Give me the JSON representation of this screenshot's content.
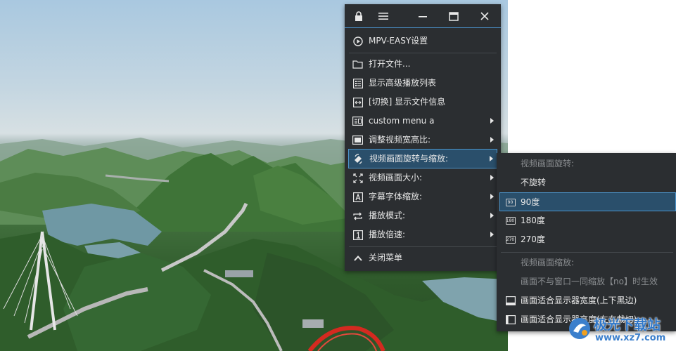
{
  "main_menu": {
    "title_buttons": [
      "lock-icon",
      "hamburger-icon",
      "minimize-icon",
      "maximize-icon",
      "close-icon"
    ],
    "settings_label": "MPV-EASY设置",
    "items": [
      {
        "label": "打开文件...",
        "icon": "folder-icon",
        "has_submenu": false
      },
      {
        "label": "显示高级播放列表",
        "icon": "playlist-icon",
        "has_submenu": false
      },
      {
        "label": "[切换] 显示文件信息",
        "icon": "toggle-info-icon",
        "has_submenu": false
      },
      {
        "label": "custom menu a",
        "icon": "custom-menu-icon",
        "has_submenu": true
      },
      {
        "label": "调整视频宽高比:",
        "icon": "aspect-ratio-icon",
        "has_submenu": true
      },
      {
        "label": "视频画面旋转与缩放:",
        "icon": "rotate-scale-icon",
        "has_submenu": true,
        "active": true
      },
      {
        "label": "视频画面大小:",
        "icon": "video-size-icon",
        "has_submenu": true
      },
      {
        "label": "字幕字体缩放:",
        "icon": "subtitle-font-icon",
        "has_submenu": true
      },
      {
        "label": "播放模式:",
        "icon": "play-mode-icon",
        "has_submenu": true
      },
      {
        "label": "播放倍速:",
        "icon": "play-speed-icon",
        "has_submenu": true
      }
    ],
    "close_label": "关闭菜单"
  },
  "sub_menu": {
    "rotate_header": "视频画面旋转:",
    "no_rotate": "不旋转",
    "rot90": "90度",
    "rot180": "180度",
    "rot270": "270度",
    "rot90_icon_text": "90",
    "rot180_icon_text": "180",
    "rot270_icon_text": "270",
    "scale_header": "视频画面缩放:",
    "no_scale": "画面不与窗口一同缩放【no】时生效",
    "fit_width": "画面适合显示器宽度(上下黑边)",
    "fit_height": "画面适合显示器高度(左右裁切)"
  },
  "watermark": {
    "line1": "极光下载站",
    "line2": "www.xz7.com"
  },
  "colors": {
    "menu_bg": "#2b2e31",
    "highlight_bg": "#2a4f6b",
    "highlight_border": "#4c95cc",
    "text": "#e8e8e8",
    "disabled_text": "#8a8d90"
  }
}
